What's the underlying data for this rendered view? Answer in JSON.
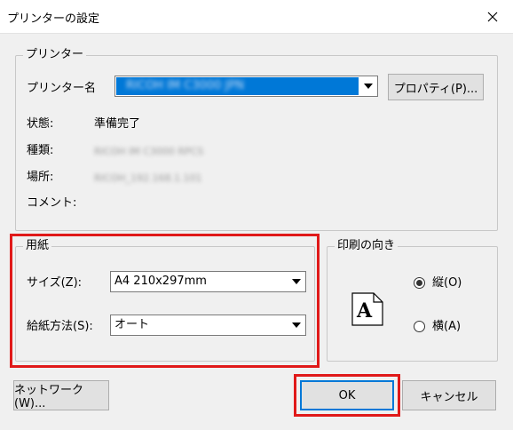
{
  "window": {
    "title": "プリンターの設定"
  },
  "printer_group": {
    "legend": "プリンター",
    "name_label": "プリンター名",
    "selected_printer": "RICOH IM C3000 JPN",
    "properties_button": "プロパティ(P)...",
    "status_label": "状態:",
    "status_value": "準備完了",
    "type_label": "種類:",
    "type_value": "RICOH IM C3000 RPCS",
    "location_label": "場所:",
    "location_value": "RICOH_192.168.1.101",
    "comment_label": "コメント:"
  },
  "paper_group": {
    "legend": "用紙",
    "size_label": "サイズ(Z):",
    "size_value": "A4 210x297mm",
    "source_label": "給紙方法(S):",
    "source_value": "オート"
  },
  "orientation_group": {
    "legend": "印刷の向き",
    "preview_letter": "A",
    "portrait_label": "縦(O)",
    "landscape_label": "横(A)",
    "selected": "portrait"
  },
  "buttons": {
    "network": "ネットワーク(W)...",
    "ok": "OK",
    "cancel": "キャンセル"
  },
  "colors": {
    "highlight": "#e01919",
    "selection": "#0078d7"
  }
}
